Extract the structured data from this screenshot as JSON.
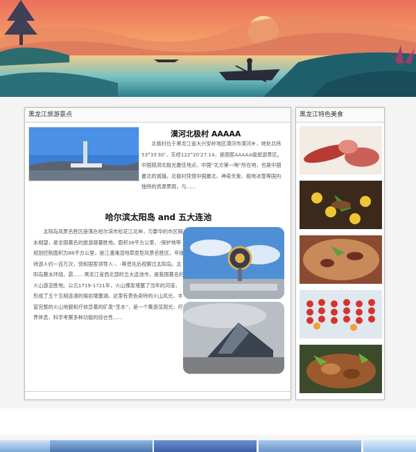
{
  "main_panel": {
    "header": "黑龙江旅游景点",
    "article1": {
      "title": "漠河北极村 AAAAA",
      "text": "北极村位于黑龙江省大兴安岭地区漠河市漠河乡，地处北纬53°33′30″、东经122°20′27.14，是国家AAAAA级旅游景区。中国观测北极光最佳地点，中国“北方第一哨”所在地，也是中国最北的城镇。北极村凭借中国最北、神奇天象、极地冰雪等国内独特的资源景观，与......"
    },
    "article2": {
      "title": "哈尔滨太阳岛 and 五大连池",
      "text": "太阳岛风景名胜区座落在哈尔滨市松花江北岸，与繁华的市区隔水相望，是全国著名的旅游避暑胜地。面积38平方公里，-保护地带规划控制面积为88平方公里，是江漫滩湿地草原型风景名胜区，年接待游人约一百万次，党和国家领导人-、-等曾先后视察过太阳岛。太阳岛簪水环绕，晨......    黑龙江省西北部的五大连池市，是我国著名的火山游览胜地。公元1719-1721年，火山爆发堵塞了当年的河道，形成了五个互相连通的熔岩堰塞湖。这里有景色奇特的火山风光、丰富完整的火山地貌和疗效显著的矿泉“圣水”，是一个集游览观光、疗养休息、科学考察多种功能的综合性......"
    }
  },
  "side_panel": {
    "header": "黑龙江特色美食"
  },
  "colors": {
    "panel_border": "#bdbdbd",
    "header_text": "#333333"
  }
}
